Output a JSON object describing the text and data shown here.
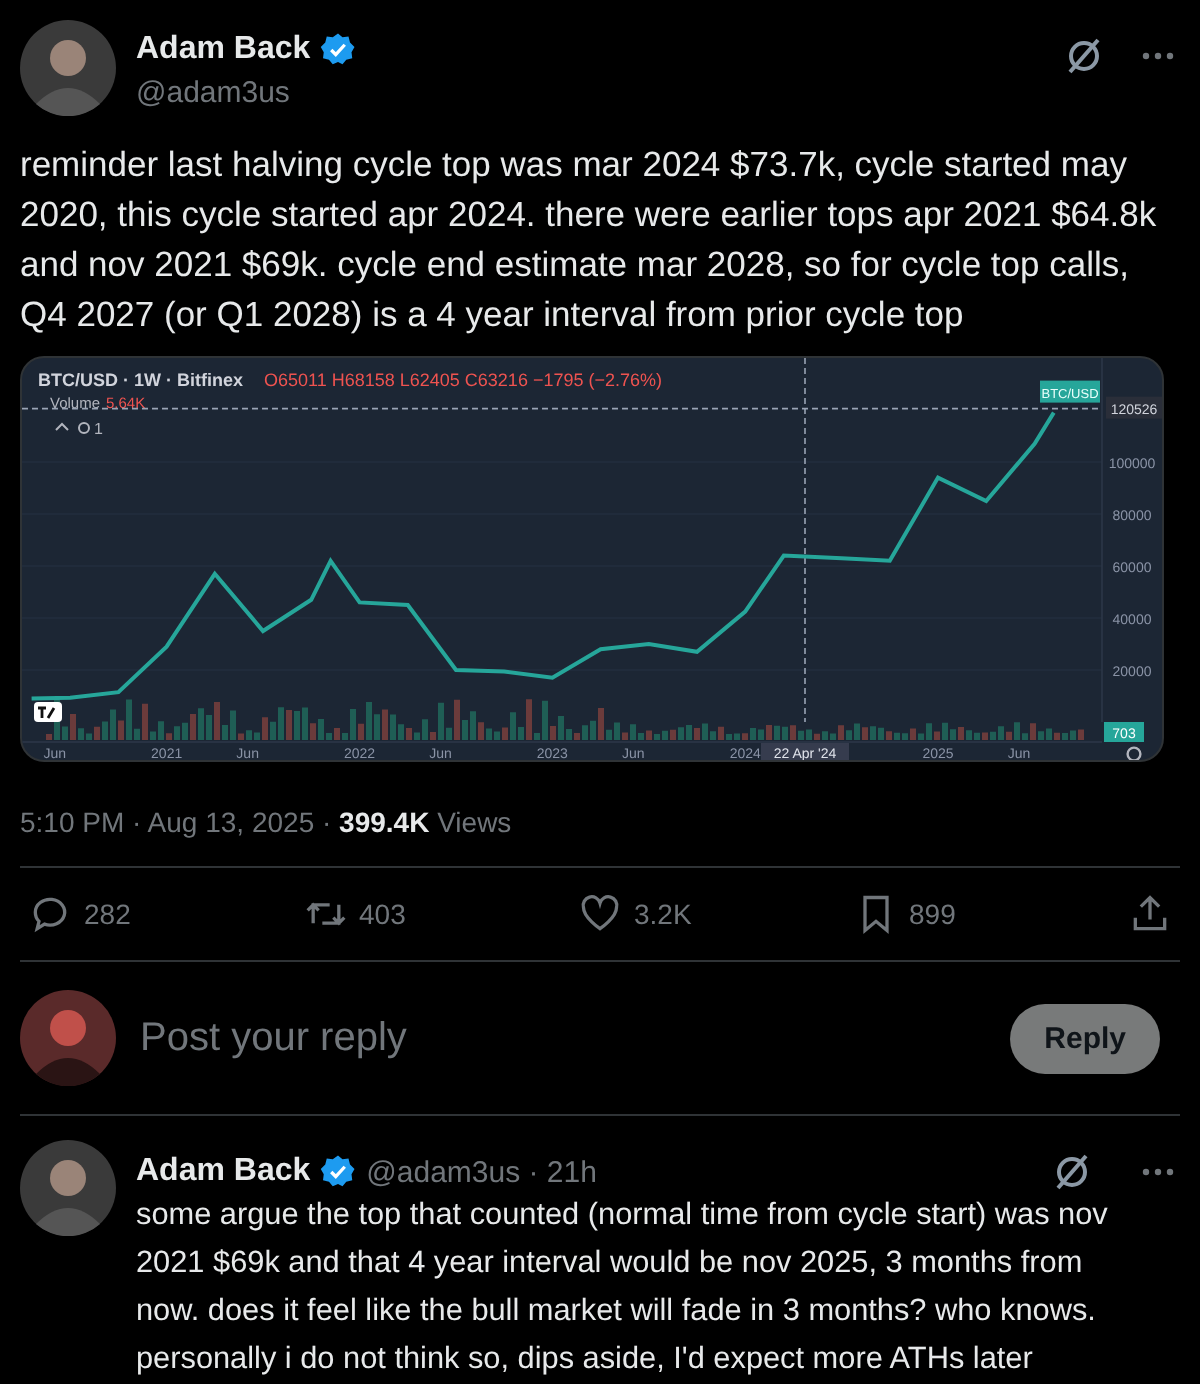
{
  "post": {
    "author": {
      "name": "Adam Back",
      "handle": "@adam3us",
      "verified": true
    },
    "text": "reminder last halving cycle top was mar 2024 $73.7k, cycle started may 2020, this cycle started apr 2024. there were earlier tops apr 2021 $64.8k and nov 2021 $69k. cycle end estimate mar 2028, so for cycle top calls, Q4 2027 (or Q1 2028) is a 4 year interval from prior cycle top",
    "chart": {
      "symbol": "BTC/USD · 1W · Bitfinex",
      "ohlc": "O65011 H68158 L62405 C63216 −1795 (−2.76%)",
      "volume_label": "Volume",
      "volume_value": "5.64K",
      "indicator_count": "1",
      "last_price": "120526",
      "volume_tag": "703",
      "crosshair_label": "22 Apr '24",
      "chart_data": {
        "type": "line",
        "x": [
          2020.3,
          2020.5,
          2020.75,
          2021.0,
          2021.25,
          2021.5,
          2021.75,
          2021.85,
          2022.0,
          2022.25,
          2022.5,
          2022.75,
          2023.0,
          2023.25,
          2023.5,
          2023.75,
          2024.0,
          2024.2,
          2024.5,
          2024.75,
          2025.0,
          2025.25,
          2025.5,
          2025.6
        ],
        "series": [
          {
            "name": "BTC/USD",
            "color": "#26a69a",
            "values": [
              9000,
              9300,
              11500,
              29000,
              57000,
              35000,
              47000,
              62000,
              46000,
              45000,
              20000,
              19500,
              17000,
              28000,
              30000,
              27000,
              42500,
              64000,
              63000,
              62000,
              94000,
              85000,
              107000,
              119000
            ]
          }
        ],
        "ref_lines": [
          {
            "axis": "y",
            "value": 120526
          },
          {
            "axis": "x",
            "value": 2024.31
          }
        ],
        "xlim": [
          2020.25,
          2025.85
        ],
        "ylim": [
          0,
          140000
        ],
        "grid": true,
        "yticks": [
          20000,
          40000,
          60000,
          80000,
          100000
        ],
        "xticks": [
          {
            "value": 2020.42,
            "label": "Jun"
          },
          {
            "value": 2021,
            "label": "2021"
          },
          {
            "value": 2021.42,
            "label": "Jun"
          },
          {
            "value": 2022,
            "label": "2022"
          },
          {
            "value": 2022.42,
            "label": "Jun"
          },
          {
            "value": 2023,
            "label": "2023"
          },
          {
            "value": 2023.42,
            "label": "Jun"
          },
          {
            "value": 2024,
            "label": "2024"
          },
          {
            "value": 2025,
            "label": "2025"
          },
          {
            "value": 2025.42,
            "label": "Jun"
          }
        ]
      }
    },
    "meta": "5:10 PM · Aug 13, 2025 · **399.4K** Views",
    "actions": [
      {
        "kind": "reply",
        "count": "282"
      },
      {
        "kind": "repost",
        "count": "403"
      },
      {
        "kind": "like",
        "count": "3.2K"
      },
      {
        "kind": "bookmark",
        "count": "899"
      },
      {
        "kind": "share"
      }
    ]
  },
  "composer": {
    "placeholder": "Post your reply",
    "button": "Reply"
  },
  "reply": {
    "author": {
      "name": "Adam Back",
      "handle": "@adam3us · 21h",
      "verified": true
    },
    "text": "some argue the top that counted (normal time from cycle start) was nov 2021 $69k and that 4 year interval would be nov 2025, 3 months from now. does it feel like the bull market will fade in 3 months? who knows. personally i do not think so, dips aside, I'd expect more ATHs later"
  }
}
